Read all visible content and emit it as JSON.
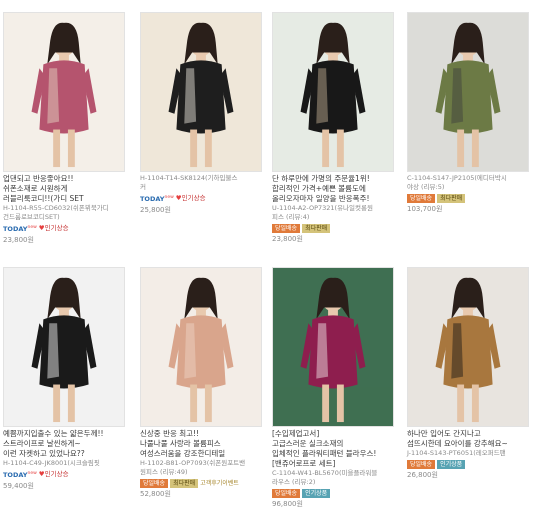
{
  "products": [
    {
      "desc": "업댄되고 반응좋아요!!\n쉬폰소재로 시원하게\n러블리룩코디!!(가디 SET",
      "code": "H-1104-R55-CD6032(쉬폰뷔북가디\n건드룸로브코디SET)",
      "badges": [
        "TODAY",
        "인기상승"
      ],
      "price": "23,800원"
    },
    {
      "desc": "",
      "code": "H-1104-T14-SK8124(기하입불스\n커",
      "badges": [
        "TODAY",
        "인기상승"
      ],
      "price": "25,800원"
    },
    {
      "desc": "단 하루만에 가명의 주문율1위!\n합리적인 가격+예쁜 볼륨도에\n올리오자마자 일양을 반응폭주!",
      "code": "U-1104-A2-OP7321(유나일컷롱원\n피스 (리뷰:4)",
      "badges": [
        "당일배송",
        "최다판매"
      ],
      "price": "23,800원"
    },
    {
      "desc": "",
      "code": "C-1104-S147-JP2105(에디터박시\n야상 (리뷰:5)",
      "badges": [
        "당일배송",
        "최다판매"
      ],
      "price": "103,700원"
    },
    {
      "desc": "예쁨까지입출수 있는 얇은두께!!\n스트라이프로 날씬하게~\n이런 자켓하고 있었나요??",
      "code": "H-1104-C49-JK8001(시크슬림핏",
      "badges": [
        "TODAY",
        "인기상승"
      ],
      "price": "59,400원"
    },
    {
      "desc": "신상중 반응 최고!!\n나풀나풀 사랑라 볼륨피스\n여성스러움을 강조한디테일",
      "code": "H-1102-B81-OP7093(쉬폰원포트밴\n원피스 (리뷰:49)",
      "badges": [
        "당일배송",
        "최다판매",
        "고객후기이벤트"
      ],
      "price": "52,800원"
    },
    {
      "desc": "[수입제업고서]\n고급스러운 실크소재의\n입체적인 플라워티패턴 블라우스!\n[밴쥬어로프로 세트]",
      "code": "C-1104-W41-BL5670(미을플라워블\n라우스 (리뷰:2)",
      "badges": [
        "당일배송",
        "인기상품"
      ],
      "price": "96,800원"
    },
    {
      "desc": "하나만 입어도 간지나고\n섬뜨시한데 요아이를 강추해요~",
      "code": "J-1104-S143-PT6051(레오퍼드팬",
      "badges": [
        "당일배송",
        "인기상품"
      ],
      "price": "26,800원"
    }
  ],
  "photos": [
    {
      "name": "cream-cardigan-photo",
      "bg": "#f4efe8",
      "dress": "#b5546e",
      "accent": "#e9ddc8"
    },
    {
      "name": "geometric-skirt-photo",
      "bg": "#efe7d9",
      "dress": "#1e1e1e",
      "accent": "#f7f2e6"
    },
    {
      "name": "black-dress-photo",
      "bg": "#e6ebe4",
      "dress": "#181818",
      "accent": "#c9b59a"
    },
    {
      "name": "khaki-parka-photo",
      "bg": "#dcdcd8",
      "dress": "#6c7a45",
      "accent": "#3b3b3b"
    },
    {
      "name": "striped-jacket-photo",
      "bg": "#f2f2f2",
      "dress": "#1a1a1a",
      "accent": "#ffffff"
    },
    {
      "name": "pink-dress-photo",
      "bg": "#f3ede7",
      "dress": "#d9a58c",
      "accent": "#f0d8c8"
    },
    {
      "name": "floral-blouse-photo",
      "bg": "#3f6f52",
      "dress": "#8e1e4e",
      "accent": "#f5f2f0"
    },
    {
      "name": "leopard-shorts-photo",
      "bg": "#e8e4df",
      "dress": "#a8773e",
      "accent": "#141414"
    }
  ]
}
